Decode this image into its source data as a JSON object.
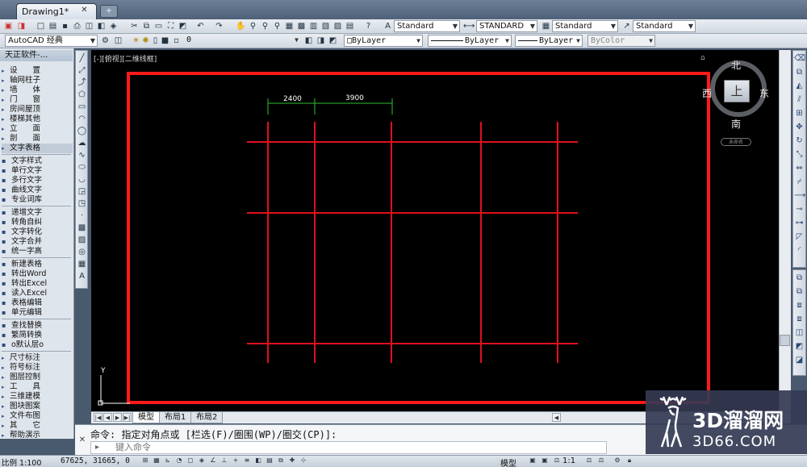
{
  "window": {
    "doc_tab": "Drawing1*",
    "doc_tab_close": "✕",
    "new_tab": "+"
  },
  "toolbar2": {
    "workspace": "AutoCAD 经典",
    "layer": "0",
    "color": "ByLayer",
    "linetype": "ByLayer",
    "lineweight": "ByLayer",
    "plotstyle": "ByColor"
  },
  "toolbar1": {
    "text_style": "Standard",
    "dim_style": "STANDARD",
    "table_style": "Standard",
    "mleader_style": "Standard"
  },
  "tianzheng": {
    "title": "天正软件-...",
    "items": [
      {
        "label": "设　　置",
        "bullet": true
      },
      {
        "label": "轴网柱子",
        "bullet": true
      },
      {
        "label": "墙　　体",
        "bullet": true
      },
      {
        "label": "门　　窗",
        "bullet": true
      },
      {
        "label": "房间屋顶",
        "bullet": true
      },
      {
        "label": "楼梯其他",
        "bullet": true
      },
      {
        "label": "立　　面",
        "bullet": true
      },
      {
        "label": "剖　　面",
        "bullet": true
      },
      {
        "label": "文字表格",
        "bullet": true,
        "active": true
      }
    ],
    "text_items": [
      {
        "label": "文字样式",
        "icon": "text-style-icon"
      },
      {
        "label": "单行文字",
        "icon": "single-text-icon"
      },
      {
        "label": "多行文字",
        "icon": "multi-text-icon"
      },
      {
        "label": "曲线文字",
        "icon": "curve-text-icon"
      },
      {
        "label": "专业词库",
        "icon": "dictionary-icon"
      }
    ],
    "edit_items": [
      {
        "label": "递增文字",
        "icon": "increment-text-icon"
      },
      {
        "label": "转角自纠",
        "icon": "rotate-fix-icon"
      },
      {
        "label": "文字转化",
        "icon": "text-convert-icon"
      },
      {
        "label": "文字合并",
        "icon": "text-merge-icon"
      },
      {
        "label": "统一字高",
        "icon": "text-height-icon"
      }
    ],
    "table_items": [
      {
        "label": "新建表格",
        "icon": "new-table-icon"
      },
      {
        "label": "转出Word",
        "icon": "word-export-icon"
      },
      {
        "label": "转出Excel",
        "icon": "excel-export-icon"
      },
      {
        "label": "读入Excel",
        "icon": "excel-import-icon"
      },
      {
        "label": "表格编辑",
        "icon": "table-edit-icon"
      },
      {
        "label": "单元编辑",
        "icon": "cell-edit-icon"
      }
    ],
    "find_items": [
      {
        "label": "查找替换",
        "icon": "find-replace-icon"
      },
      {
        "label": "繁简转换",
        "icon": "trad-simp-icon"
      },
      {
        "label": "o默认层o",
        "icon": "default-layer-icon"
      }
    ],
    "bottom_items": [
      {
        "label": "尺寸标注"
      },
      {
        "label": "符号标注"
      },
      {
        "label": "图层控制"
      },
      {
        "label": "工　　具"
      },
      {
        "label": "三维建模"
      },
      {
        "label": "图块图案"
      },
      {
        "label": "文件布图"
      },
      {
        "label": "其　　它"
      },
      {
        "label": "帮助演示"
      }
    ]
  },
  "viewport": {
    "label": "[-][俯视][二维线框]"
  },
  "drawing": {
    "dim1": "2400",
    "dim2": "3900",
    "ucs_y": "Y"
  },
  "viewcube": {
    "face": "上",
    "north": "北",
    "south": "南",
    "east": "东",
    "west": "西",
    "wcs": "未命名"
  },
  "layout_tabs": [
    "模型",
    "布局1",
    "布局2"
  ],
  "command": {
    "prompt": "命令: 指定对角点或 [栏选(F)/圈围(WP)/圈交(CP)]:",
    "placeholder": "键入命令"
  },
  "status": {
    "scale": "比例 1:100",
    "coords": "67625, 31665, 0",
    "model": "模型",
    "annoscale": "1:1"
  },
  "watermark": {
    "cn": "3D溜溜网",
    "en": "3D66.COM"
  },
  "colors": {
    "canvas": "#000000",
    "frame": "#ff1a1a",
    "grid": "#e0101e",
    "dimension": "#2fbf3a",
    "accent": "#4a5a6e"
  }
}
